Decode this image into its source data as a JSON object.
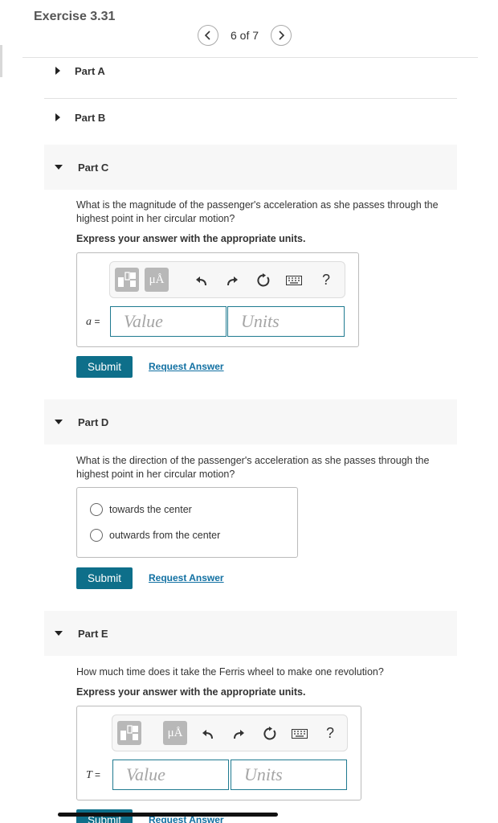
{
  "exercise": {
    "title": "Exercise 3.31"
  },
  "pager": {
    "text": "6 of 7"
  },
  "parts": {
    "a": {
      "label": "Part A"
    },
    "b": {
      "label": "Part B"
    },
    "c": {
      "label": "Part C",
      "question": "What is the magnitude of the passenger's acceleration as she passes through the highest point in her circular motion?",
      "instruction": "Express your answer with the appropriate units.",
      "variable": "a",
      "equals": "=",
      "value_placeholder": "Value",
      "units_placeholder": "Units",
      "submit": "Submit",
      "request": "Request Answer"
    },
    "d": {
      "label": "Part D",
      "question": "What is the direction of the passenger's acceleration as she passes through the highest point in her circular motion?",
      "options": [
        "towards the center",
        "outwards from the center"
      ],
      "submit": "Submit",
      "request": "Request Answer"
    },
    "e": {
      "label": "Part E",
      "question": "How much time does it take the Ferris wheel to make one revolution?",
      "instruction": "Express your answer with the appropriate units.",
      "variable": "T",
      "equals": "=",
      "value_placeholder": "Value",
      "units_placeholder": "Units",
      "submit": "Submit",
      "request": "Request Answer"
    }
  },
  "toolbar": {
    "units_button_text": "μÅ",
    "help_text": "?",
    "icons": [
      "templates-icon",
      "units-icon",
      "undo-icon",
      "redo-icon",
      "reset-icon",
      "keyboard-icon",
      "help-icon"
    ]
  },
  "colors": {
    "accent": "#0e6f8a",
    "link": "#1170a2",
    "field_border": "#1f7a90"
  }
}
